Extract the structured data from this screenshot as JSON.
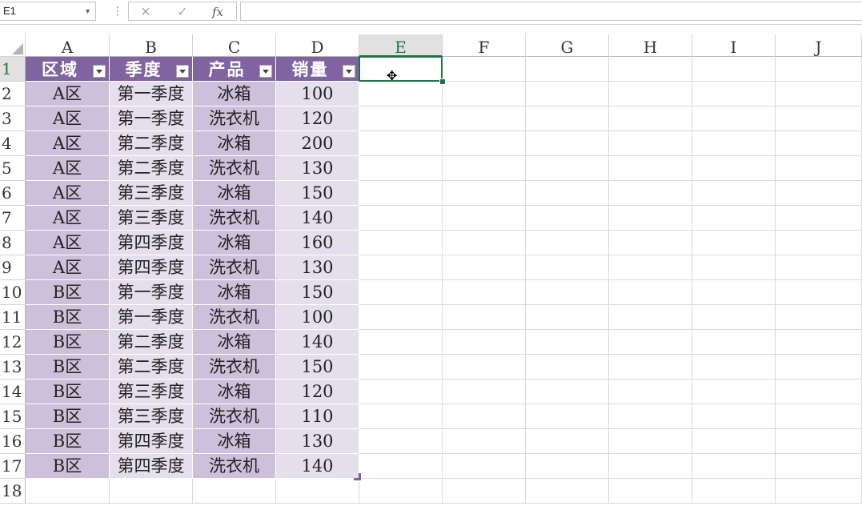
{
  "namebox": {
    "value": "E1"
  },
  "formula_bar": {
    "cancel_icon": "✕",
    "enter_icon": "✓",
    "fx_label": "fx",
    "formula_value": ""
  },
  "columns": [
    "A",
    "B",
    "C",
    "D",
    "E",
    "F",
    "G",
    "H",
    "I",
    "J"
  ],
  "selected_column": "E",
  "rows": [
    "1",
    "2",
    "3",
    "4",
    "5",
    "6",
    "7",
    "8",
    "9",
    "10",
    "11",
    "12",
    "13",
    "14",
    "15",
    "16",
    "17",
    "18"
  ],
  "table": {
    "headers": [
      "区域",
      "季度",
      "产品",
      "销量"
    ],
    "rows": [
      [
        "A区",
        "第一季度",
        "冰箱",
        "100"
      ],
      [
        "A区",
        "第一季度",
        "洗衣机",
        "120"
      ],
      [
        "A区",
        "第二季度",
        "冰箱",
        "200"
      ],
      [
        "A区",
        "第二季度",
        "洗衣机",
        "130"
      ],
      [
        "A区",
        "第三季度",
        "冰箱",
        "150"
      ],
      [
        "A区",
        "第三季度",
        "洗衣机",
        "140"
      ],
      [
        "A区",
        "第四季度",
        "冰箱",
        "160"
      ],
      [
        "A区",
        "第四季度",
        "洗衣机",
        "130"
      ],
      [
        "B区",
        "第一季度",
        "冰箱",
        "150"
      ],
      [
        "B区",
        "第一季度",
        "洗衣机",
        "100"
      ],
      [
        "B区",
        "第二季度",
        "冰箱",
        "140"
      ],
      [
        "B区",
        "第二季度",
        "洗衣机",
        "150"
      ],
      [
        "B区",
        "第三季度",
        "冰箱",
        "120"
      ],
      [
        "B区",
        "第三季度",
        "洗衣机",
        "110"
      ],
      [
        "B区",
        "第四季度",
        "冰箱",
        "130"
      ],
      [
        "B区",
        "第四季度",
        "洗衣机",
        "140"
      ]
    ]
  },
  "colors": {
    "table_header": "#8064a2",
    "band_dark": "#ccc0da",
    "band_light": "#e4dfec",
    "selection": "#217346"
  },
  "icons": {
    "filter": "filter-dropdown-icon",
    "cursor": "move-cursor-icon"
  }
}
